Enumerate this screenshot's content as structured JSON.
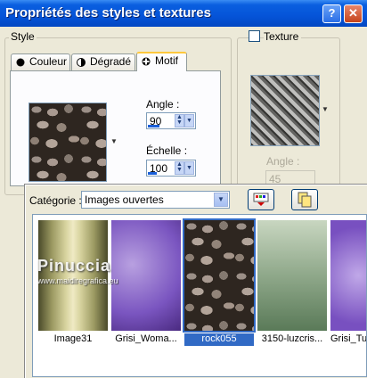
{
  "window": {
    "title": "Propriétés des styles et textures",
    "help_glyph": "?",
    "close_glyph": "✕"
  },
  "style_group": {
    "legend": "Style",
    "tabs": [
      {
        "label": "Couleur"
      },
      {
        "label": "Dégradé"
      },
      {
        "label": "Motif"
      }
    ],
    "active_tab": "Motif",
    "angle_label": "Angle :",
    "angle_value": "90",
    "angle_level": 0.25,
    "scale_label": "Échelle :",
    "scale_value": "100",
    "scale_level": 0.2
  },
  "texture_group": {
    "checkbox_label": "Texture",
    "checked": false,
    "angle_label": "Angle :",
    "angle_value": "45"
  },
  "pattern_popup": {
    "category_label": "Catégorie :",
    "category_value": "Images ouvertes",
    "thumbnails": [
      {
        "caption": "Image31",
        "selected": false
      },
      {
        "caption": "Grisi_Woma...",
        "selected": false
      },
      {
        "caption": "rock055",
        "selected": true
      },
      {
        "caption": "3150-luzcris...",
        "selected": false
      },
      {
        "caption": "Grisi_Tu",
        "selected": false
      }
    ],
    "watermark": "Pinuccia",
    "watermark_sub": "www.maidiregrafica.eu"
  },
  "colors": {
    "titlebar": "#0554d8",
    "selection": "#316ac5",
    "active_tab_accent": "#ffc83c"
  }
}
